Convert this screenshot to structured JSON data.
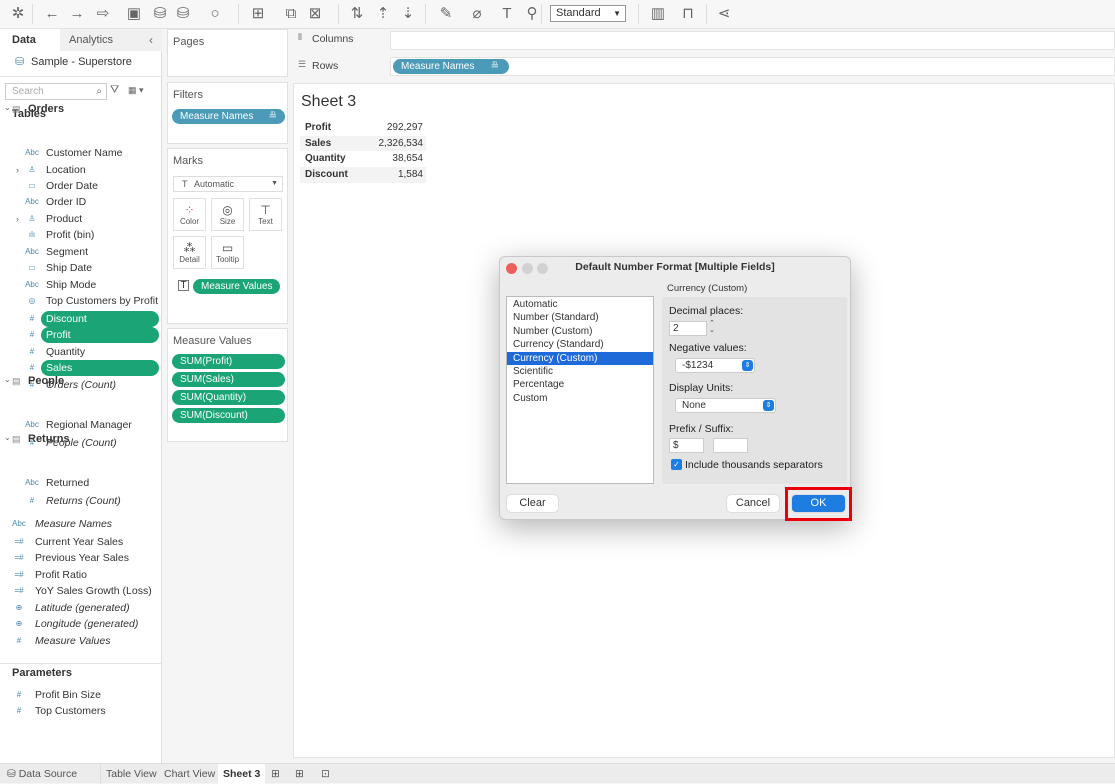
{
  "toolbar": {
    "icons": [
      "tableau-logo-icon",
      "back-icon",
      "forward-icon",
      "redo-icon",
      "save-icon",
      "new-datasource-icon",
      "pause-update-icon",
      "refresh-icon",
      "new-worksheet-icon",
      "duplicate-sheet-icon",
      "clear-sheet-icon",
      "swap-icon",
      "sort-ascending-icon",
      "sort-descending-icon",
      "highlight-icon",
      "group-icon",
      "label-icon",
      "pin-icon",
      "show-me-icon",
      "presentation-icon",
      "share-icon"
    ],
    "fit_select": "Standard"
  },
  "sidebar": {
    "tabs": [
      "Data",
      "Analytics"
    ],
    "datasource": "Sample - Superstore",
    "search_placeholder": "Search",
    "tables_heading": "Tables",
    "groups": [
      "Orders",
      "People",
      "Returns"
    ],
    "fields": [
      {
        "label": "Customer Name",
        "icon": "Abc"
      },
      {
        "label": "Location",
        "icon": "geo",
        "expand": true
      },
      {
        "label": "Order Date",
        "icon": "date"
      },
      {
        "label": "Order ID",
        "icon": "Abc"
      },
      {
        "label": "Product",
        "icon": "geo",
        "expand": true
      },
      {
        "label": "Profit (bin)",
        "icon": "bin"
      },
      {
        "label": "Segment",
        "icon": "Abc"
      },
      {
        "label": "Ship Date",
        "icon": "date"
      },
      {
        "label": "Ship Mode",
        "icon": "Abc"
      },
      {
        "label": "Top Customers by Profit",
        "icon": "set"
      },
      {
        "label": "Discount",
        "icon": "#",
        "selected": true
      },
      {
        "label": "Profit",
        "icon": "#",
        "selected": true
      },
      {
        "label": "Quantity",
        "icon": "#"
      },
      {
        "label": "Sales",
        "icon": "#",
        "selected": true
      },
      {
        "label": "Orders (Count)",
        "icon": "#",
        "italic": true
      },
      {
        "label": "Regional Manager",
        "icon": "Abc"
      },
      {
        "label": "People (Count)",
        "icon": "#",
        "italic": true
      },
      {
        "label": "Returned",
        "icon": "Abc"
      },
      {
        "label": "Returns (Count)",
        "icon": "#",
        "italic": true
      },
      {
        "label": "Measure Names",
        "icon": "Abc",
        "italic": true,
        "outer": true
      },
      {
        "label": "Current Year Sales",
        "icon": "=#",
        "outer": true
      },
      {
        "label": "Previous Year Sales",
        "icon": "=#",
        "outer": true
      },
      {
        "label": "Profit Ratio",
        "icon": "=#",
        "outer": true
      },
      {
        "label": "YoY Sales Growth (Loss)",
        "icon": "=#",
        "outer": true
      },
      {
        "label": "Latitude (generated)",
        "icon": "globe",
        "italic": true,
        "outer": true
      },
      {
        "label": "Longitude (generated)",
        "icon": "globe",
        "italic": true,
        "outer": true
      },
      {
        "label": "Measure Values",
        "icon": "#",
        "italic": true,
        "outer": true
      }
    ],
    "parameters_heading": "Parameters",
    "parameters": [
      {
        "label": "Profit Bin Size",
        "icon": "#"
      },
      {
        "label": "Top Customers",
        "icon": "#"
      }
    ]
  },
  "cards": {
    "pages": "Pages",
    "filters": "Filters",
    "filter_pill": "Measure Names",
    "marks": "Marks",
    "mark_type": "Automatic",
    "mark_buttons": [
      "Color",
      "Size",
      "Text",
      "Detail",
      "Tooltip"
    ],
    "marks_pill": "Measure Values",
    "measure_values": "Measure Values",
    "measure_pills": [
      "SUM(Profit)",
      "SUM(Sales)",
      "SUM(Quantity)",
      "SUM(Discount)"
    ]
  },
  "shelves": {
    "columns": "Columns",
    "rows": "Rows",
    "rows_pill": "Measure Names"
  },
  "view": {
    "title": "Sheet 3",
    "rows": [
      {
        "name": "Profit",
        "value": "292,297"
      },
      {
        "name": "Sales",
        "value": "2,326,534"
      },
      {
        "name": "Quantity",
        "value": "38,654"
      },
      {
        "name": "Discount",
        "value": "1,584"
      }
    ]
  },
  "dialog": {
    "title": "Default Number Format [Multiple Fields]",
    "formats": [
      "Automatic",
      "Number (Standard)",
      "Number (Custom)",
      "Currency (Standard)",
      "Currency (Custom)",
      "Scientific",
      "Percentage",
      "Custom"
    ],
    "selected_format": "Currency (Custom)",
    "panel_title": "Currency (Custom)",
    "decimal_label": "Decimal places:",
    "decimal_value": "2",
    "negative_label": "Negative values:",
    "negative_value": "-$1234",
    "units_label": "Display Units:",
    "units_value": "None",
    "prefix_label": "Prefix / Suffix:",
    "prefix_value": "$",
    "suffix_value": "",
    "thousands_label": "Include thousands separators",
    "thousands_checked": true,
    "clear": "Clear",
    "cancel": "Cancel",
    "ok": "OK",
    "highlight_color": "#e8000b",
    "accent_color": "#1d7de0"
  },
  "bottom_tabs": {
    "datasource": "Data Source",
    "sheets": [
      "Table View",
      "Chart View",
      "Sheet 3"
    ],
    "active": "Sheet 3",
    "actions": [
      "new-worksheet-icon",
      "new-dashboard-icon",
      "new-story-icon"
    ]
  }
}
